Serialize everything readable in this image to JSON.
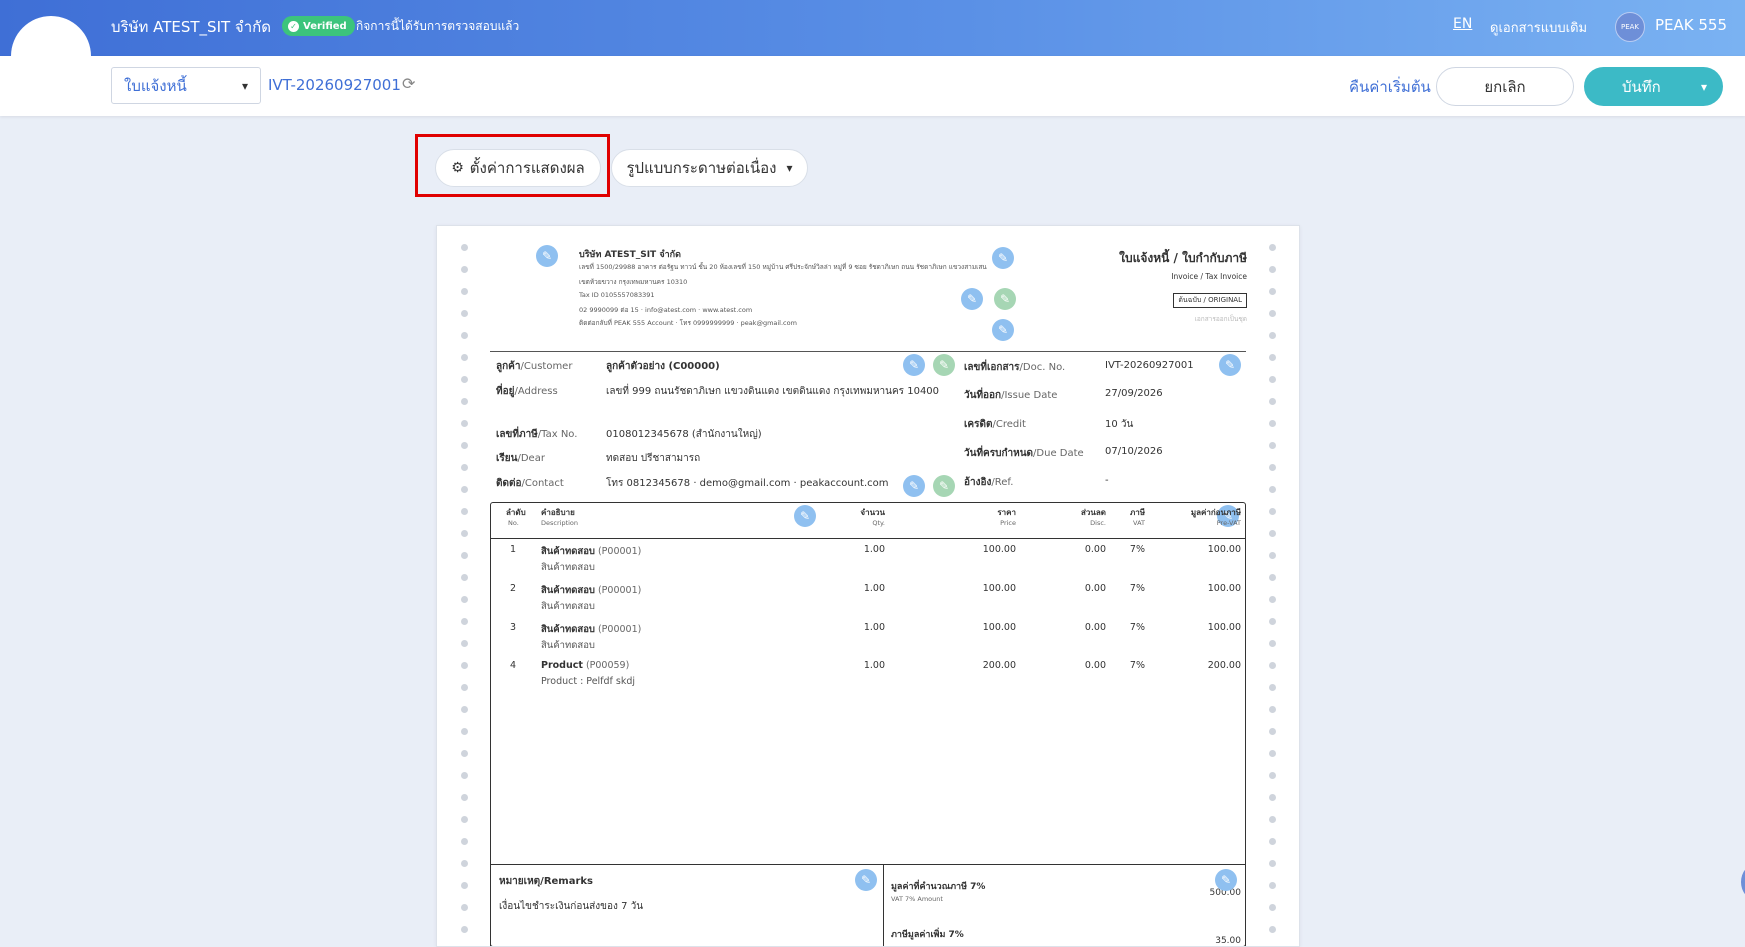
{
  "topbar": {
    "company": "บริษัท ATEST_SIT จำกัด",
    "verified_badge": "Verified",
    "verified_text": "กิจการนี้ได้รับการตรวจสอบแล้ว",
    "lang": "EN",
    "old_doc_link": "ดูเอกสารแบบเดิม",
    "avatar_text": "PEAK",
    "user": "PEAK 555"
  },
  "subbar": {
    "doc_type": "ใบแจ้งหนี้",
    "doc_number": "IVT-20260927001",
    "reset": "คืนค่าเริ่มต้น",
    "cancel": "ยกเลิก",
    "save": "บันทึก"
  },
  "toolbar": {
    "display_settings": "ตั้งค่าการแสดงผล",
    "paper_format": "รูปแบบกระดาษต่อเนื่อง"
  },
  "document": {
    "company_name": "บริษัท ATEST_SIT จำกัด",
    "company_address": "เลขที่ 1500/29988 อาคาร ต่อรัฐน ทาวน์ ชั้น 20 ห้องเลขที่ 150 หมู่บ้าน ศรีประจักษ์วิลล่า หมู่ที่ 9 ซอย รัชดาภิเษก ถนน รัชดาภิเษก แขวงสามเสน",
    "company_address2": "เขตห้วยขวาง กรุงเทพมหานคร 10310",
    "company_tax": "Tax ID 0105557083391",
    "company_phone": "02 9990099 ต่อ 15 · info@atest.com · www.atest.com",
    "company_contact": "ติดต่อกลับที่ PEAK 555 Account · โทร 0999999999 · peak@gmail.com",
    "title": "ใบแจ้งหนี้ / ใบกำกับภาษี",
    "subtitle": "Invoice / Tax Invoice",
    "original_badge": "ต้นฉบับ / ORIGINAL",
    "original_note": "เอกสารออกเป็นชุด",
    "customer_label_th": "ลูกค้า",
    "customer_label_en": "/Customer",
    "customer_value": "ลูกค้าตัวอย่าง (C00000)",
    "address_label_th": "ที่อยู่",
    "address_label_en": "/Address",
    "address_value": "เลขที่ 999 ถนนรัชดาภิเษก แขวงดินแดง เขตดินแดง กรุงเทพมหานคร 10400",
    "tax_label_th": "เลขที่ภาษี",
    "tax_label_en": "/Tax No.",
    "tax_value": "0108012345678 (สำนักงานใหญ่)",
    "dear_label_th": "เรียน",
    "dear_label_en": "/Dear",
    "dear_value": "ทดสอบ ปรีชาสามารถ",
    "contact_label_th": "ติดต่อ",
    "contact_label_en": "/Contact",
    "contact_value": "โทร 0812345678 · demo@gmail.com · peakaccount.com",
    "docno_label_th": "เลขที่เอกสาร",
    "docno_label_en": "/Doc. No.",
    "docno_value": "IVT-20260927001",
    "issue_label_th": "วันที่ออก",
    "issue_label_en": "/Issue Date",
    "issue_value": "27/09/2026",
    "credit_label_th": "เครดิต",
    "credit_label_en": "/Credit",
    "credit_value": "10 วัน",
    "due_label_th": "วันที่ครบกำหนด",
    "due_label_en": "/Due Date",
    "due_value": "07/10/2026",
    "ref_label_th": "อ้างอิง",
    "ref_label_en": "/Ref.",
    "ref_value": "-",
    "columns": {
      "no_th": "ลำดับ",
      "no_en": "No.",
      "desc_th": "คำอธิบาย",
      "desc_en": "Description",
      "qty_th": "จำนวน",
      "qty_en": "Qty.",
      "price_th": "ราคา",
      "price_en": "Price",
      "disc_th": "ส่วนลด",
      "disc_en": "Disc.",
      "vat_th": "ภาษี",
      "vat_en": "VAT",
      "amount_th": "มูลค่าก่อนภาษี",
      "amount_en": "Pre-VAT"
    },
    "items": [
      {
        "no": "1",
        "name": "สินค้าทดสอบ",
        "code": " (P00001)",
        "desc": "สินค้าทดสอบ",
        "qty": "1.00",
        "price": "100.00",
        "disc": "0.00",
        "vat": "7%",
        "amount": "100.00"
      },
      {
        "no": "2",
        "name": "สินค้าทดสอบ",
        "code": " (P00001)",
        "desc": "สินค้าทดสอบ",
        "qty": "1.00",
        "price": "100.00",
        "disc": "0.00",
        "vat": "7%",
        "amount": "100.00"
      },
      {
        "no": "3",
        "name": "สินค้าทดสอบ",
        "code": " (P00001)",
        "desc": "สินค้าทดสอบ",
        "qty": "1.00",
        "price": "100.00",
        "disc": "0.00",
        "vat": "7%",
        "amount": "100.00"
      },
      {
        "no": "4",
        "name": "Product",
        "code": " (P00059)",
        "desc": "Product : Pelfdf skdj",
        "qty": "1.00",
        "price": "200.00",
        "disc": "0.00",
        "vat": "7%",
        "amount": "200.00"
      }
    ],
    "remarks_label": "หมายเหตุ/Remarks",
    "remarks_value": "เงื่อนไขชำระเงินก่อนส่งของ 7 วัน",
    "vat_base_label": "มูลค่าที่คำนวณภาษี 7%",
    "vat_base_sub": "VAT 7% Amount",
    "vat_base_value": "500.00",
    "vat_label": "ภาษีมูลค่าเพิ่ม 7%",
    "vat_value": "35.00"
  },
  "icons": {
    "pencil": "✎",
    "gear": "⚙",
    "refresh": "⟳",
    "chevron": "⌄"
  },
  "colors": {
    "brand": "#3f6fd6",
    "save": "#3cbac6",
    "verified": "#3cc47c",
    "highlight": "#e00000"
  }
}
